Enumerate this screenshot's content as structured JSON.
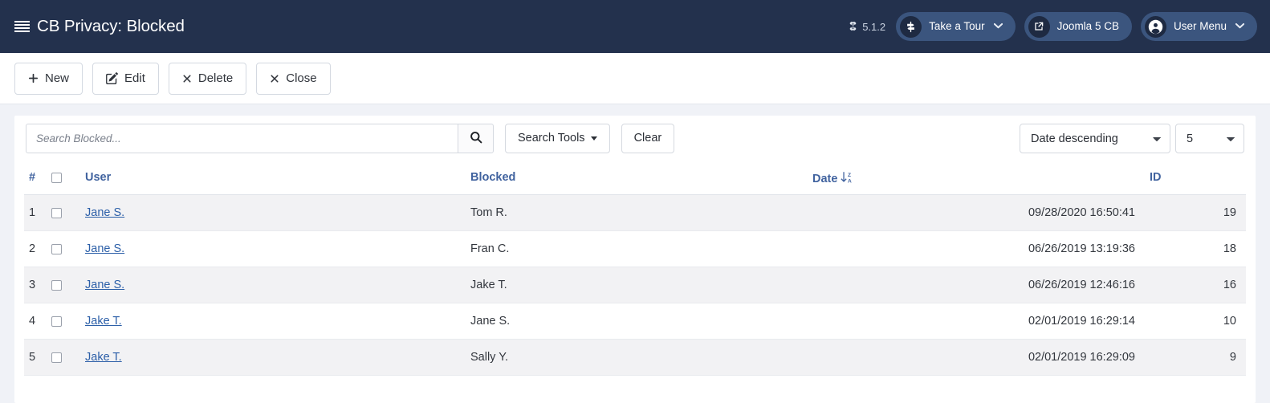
{
  "header": {
    "menu_icon": "list-grid-icon",
    "title": "CB Privacy: Blocked",
    "version": "5.1.2",
    "joomla_glyph": "⛭",
    "tour_label": "Take a Tour",
    "site_label": "Joomla 5 CB",
    "user_label": "User Menu",
    "bg_color": "#23314d",
    "chip_color": "#3b557e"
  },
  "toolbar": {
    "new_label": "New",
    "edit_label": "Edit",
    "delete_label": "Delete",
    "close_label": "Close"
  },
  "search": {
    "placeholder": "Search Blocked...",
    "value": "",
    "search_icon": "magnifier-icon",
    "tools_label": "Search Tools",
    "clear_label": "Clear",
    "order_value": "Date descending",
    "order_options": [
      "Date descending"
    ],
    "limit_value": "5",
    "limit_options": [
      "5"
    ]
  },
  "table": {
    "columns": {
      "num": "#",
      "user": "User",
      "blocked": "Blocked",
      "date": "Date",
      "id": "ID"
    },
    "sort_icon": "sort-descending-za-icon",
    "rows": [
      {
        "num": "1",
        "user": "Jane S.",
        "blocked": "Tom R.",
        "date": "09/28/2020 16:50:41",
        "id": "19"
      },
      {
        "num": "2",
        "user": "Jane S.",
        "blocked": "Fran C.",
        "date": "06/26/2019 13:19:36",
        "id": "18"
      },
      {
        "num": "3",
        "user": "Jane S.",
        "blocked": "Jake T.",
        "date": "06/26/2019 12:46:16",
        "id": "16"
      },
      {
        "num": "4",
        "user": "Jake T.",
        "blocked": "Jane S.",
        "date": "02/01/2019 16:29:14",
        "id": "10"
      },
      {
        "num": "5",
        "user": "Jake T.",
        "blocked": "Sally Y.",
        "date": "02/01/2019 16:29:09",
        "id": "9"
      }
    ]
  },
  "colors": {
    "link": "#2c5fa8",
    "header_link": "#41639f",
    "page_bg": "#f0f2f7",
    "stripe": "#f2f2f4"
  }
}
